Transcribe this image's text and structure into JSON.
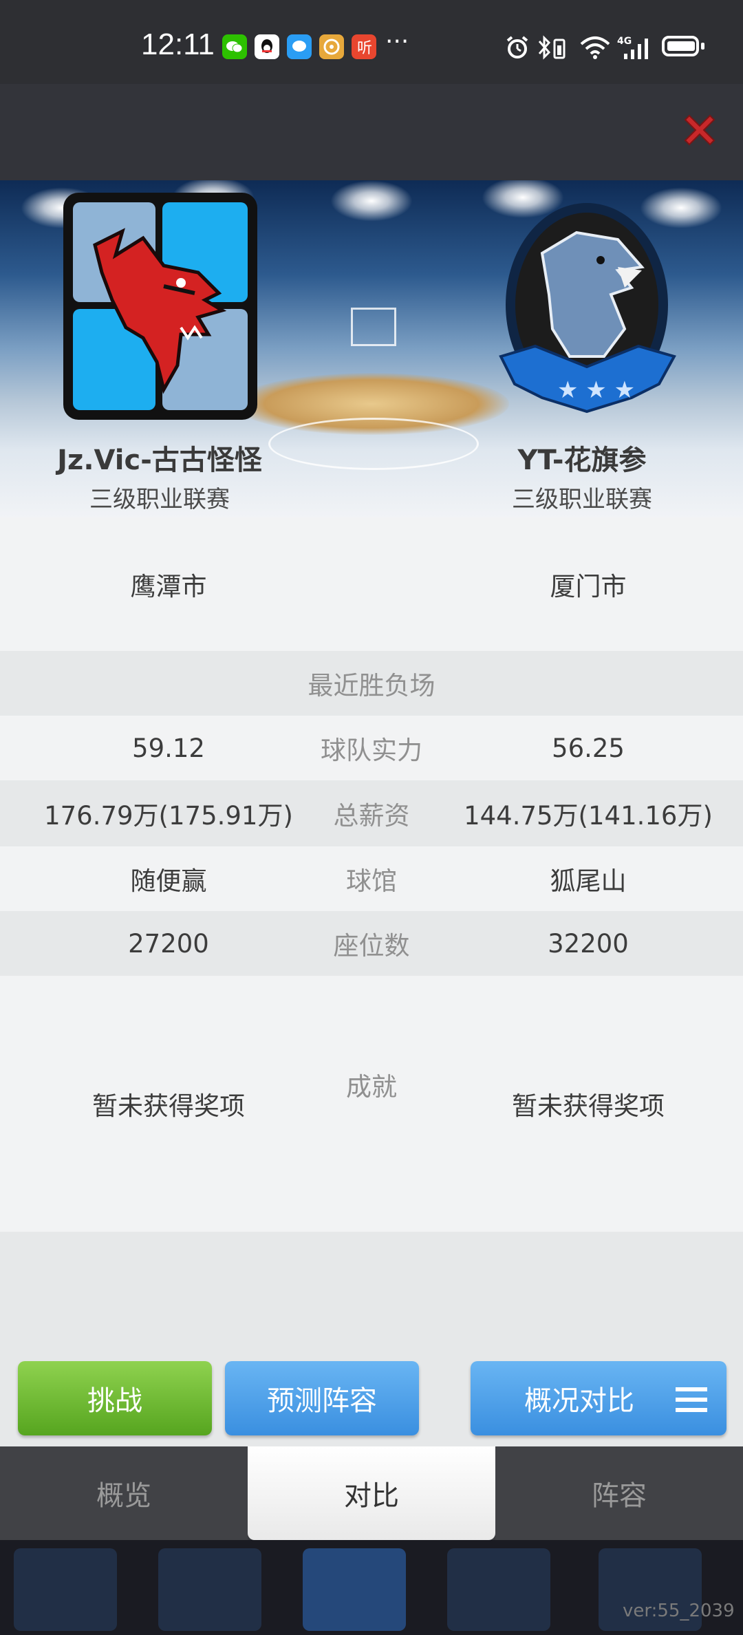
{
  "status_bar": {
    "time": "12:11",
    "more": "···",
    "network": "4G",
    "apps": [
      {
        "icon": "wechat-icon",
        "color": "#2dc100"
      },
      {
        "icon": "qq-icon",
        "color": "#ffffff"
      },
      {
        "icon": "message-icon",
        "color": "#2a9df4"
      },
      {
        "icon": "album-icon",
        "color": "#e7a83b"
      },
      {
        "icon": "listen-icon",
        "color": "#e8462f"
      }
    ]
  },
  "teams": {
    "left": {
      "name": "Jz.Vic-古古怪怪",
      "league": "三级职业联赛",
      "logo": "red-dragon-logo"
    },
    "right": {
      "name": "YT-花旗参",
      "league": "三级职业联赛",
      "logo": "blue-eagle-logo"
    }
  },
  "compare": {
    "city": {
      "left": "鹰潭市",
      "right": "厦门市"
    },
    "recent": {
      "label": "最近胜负场"
    },
    "strength": {
      "left": "59.12",
      "label": "球队实力",
      "right": "56.25"
    },
    "salary": {
      "left": "176.79万(175.91万)",
      "label": "总薪资",
      "right": "144.75万(141.16万)"
    },
    "arena": {
      "left": "随便赢",
      "label": "球馆",
      "right": "狐尾山"
    },
    "seats": {
      "left": "27200",
      "label": "座位数",
      "right": "32200"
    },
    "achievements": {
      "left": "暂未获得奖项",
      "label": "成就",
      "right": "暂未获得奖项"
    }
  },
  "buttons": {
    "challenge": "挑战",
    "predict": "预测阵容",
    "compare": "概况对比"
  },
  "tabs": [
    {
      "label": "概览",
      "active": false
    },
    {
      "label": "对比",
      "active": true
    },
    {
      "label": "阵容",
      "active": false
    }
  ],
  "version": "ver:55_2039",
  "colors": {
    "accent_green": "#6cc034",
    "accent_blue": "#4a9de6",
    "close_red": "#c8282a"
  }
}
